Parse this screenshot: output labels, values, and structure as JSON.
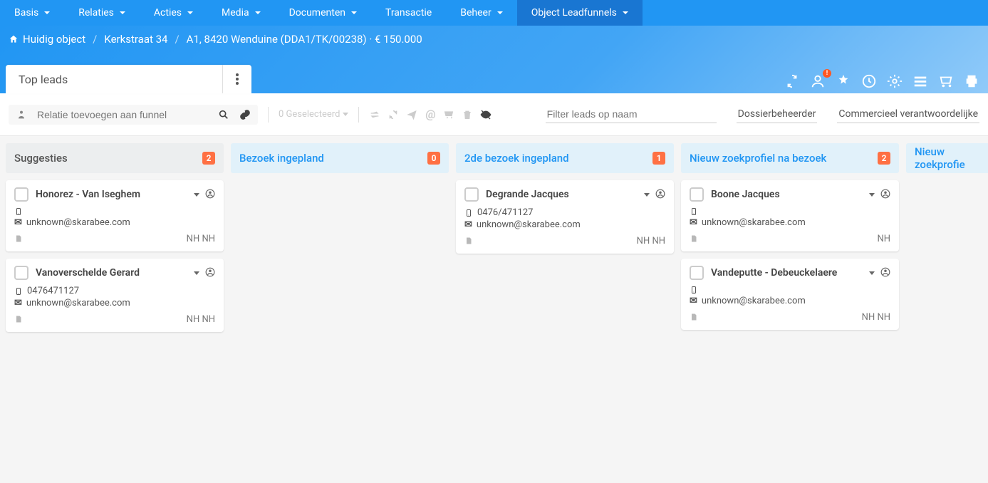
{
  "nav": {
    "items": [
      {
        "label": "Basis",
        "dropdown": true
      },
      {
        "label": "Relaties",
        "dropdown": true
      },
      {
        "label": "Acties",
        "dropdown": true
      },
      {
        "label": "Media",
        "dropdown": true
      },
      {
        "label": "Documenten",
        "dropdown": true
      },
      {
        "label": "Transactie",
        "dropdown": false
      },
      {
        "label": "Beheer",
        "dropdown": true
      },
      {
        "label": "Object Leadfunnels",
        "dropdown": true,
        "active": true
      }
    ]
  },
  "breadcrumb": {
    "home": "Huidig object",
    "street": "Kerkstraat 34",
    "rest": "A1, 8420 Wenduine (DDA1/TK/00238) · € 150.000"
  },
  "title_tab": "Top leads",
  "header_badge": "!",
  "toolbar": {
    "relation_placeholder": "Relatie toevoegen aan funnel",
    "selected_label": "0 Geselecteerd",
    "filter_placeholder": "Filter leads op naam",
    "field1": "Dossierbeheerder",
    "field2": "Commercieel verantwoordelijke"
  },
  "columns": [
    {
      "title": "Suggesties",
      "gray": true,
      "count": "2",
      "cards": [
        {
          "name": "Honorez - Van Iseghem",
          "phone": "",
          "email": "unknown@skarabee.com",
          "initials": "NH NH"
        },
        {
          "name": "Vanoverschelde Gerard",
          "phone": "0476471127",
          "email": "unknown@skarabee.com",
          "initials": "NH NH"
        }
      ]
    },
    {
      "title": "Bezoek ingepland",
      "count": "0",
      "cards": []
    },
    {
      "title": "2de bezoek ingepland",
      "count": "1",
      "cards": [
        {
          "name": "Degrande Jacques",
          "phone": "0476/471127",
          "email": "unknown@skarabee.com",
          "initials": "NH NH"
        }
      ]
    },
    {
      "title": "Nieuw zoekprofiel na bezoek",
      "count": "2",
      "cards": [
        {
          "name": "Boone Jacques",
          "phone": "",
          "email": "unknown@skarabee.com",
          "initials": "NH"
        },
        {
          "name": "Vandeputte - Debeuckelaere",
          "phone": "",
          "email": "unknown@skarabee.com",
          "initials": "NH NH"
        }
      ]
    },
    {
      "title": "Nieuw zoekprofie",
      "count": "",
      "cards": [],
      "cutoff": true
    }
  ]
}
